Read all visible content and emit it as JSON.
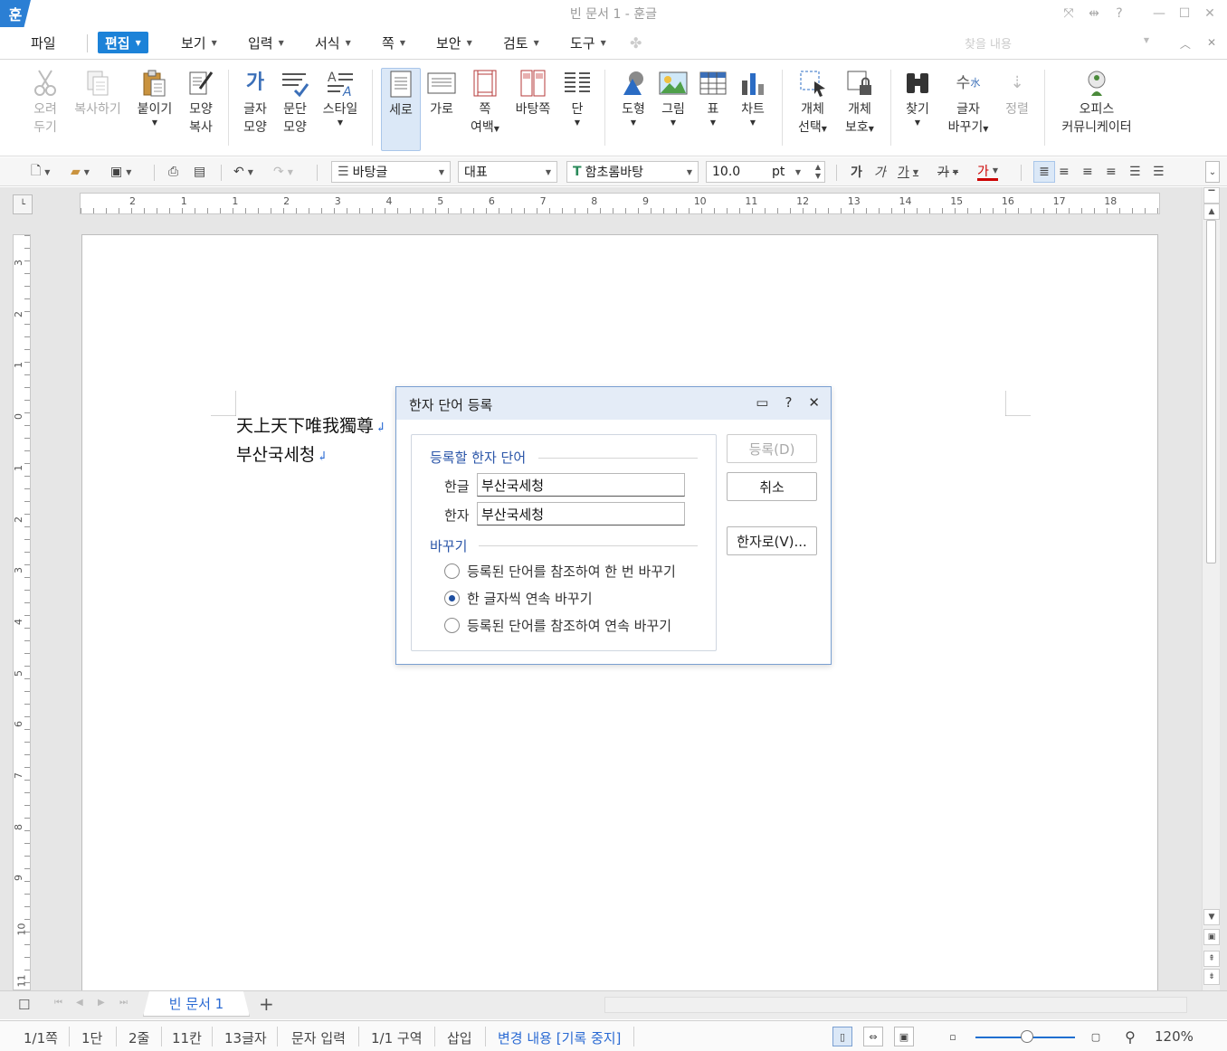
{
  "app": {
    "title": "빈 문서 1 - 훈글",
    "icon_letter": "훈"
  },
  "window_controls": [
    "full-screen-icon",
    "split-icon",
    "help-icon",
    "minimize-icon",
    "maximize-icon",
    "close-icon"
  ],
  "menubar": {
    "file": "파일",
    "items": [
      {
        "label": "편집",
        "active": true
      },
      {
        "label": "보기"
      },
      {
        "label": "입력"
      },
      {
        "label": "서식"
      },
      {
        "label": "쪽"
      },
      {
        "label": "보안"
      },
      {
        "label": "검토"
      },
      {
        "label": "도구"
      }
    ],
    "search_placeholder": "찾을 내용"
  },
  "ribbon": {
    "cut": [
      "오려",
      "두기"
    ],
    "copy": "복사하기",
    "paste": "붙이기",
    "format_copy": [
      "모양",
      "복사"
    ],
    "char_shape": [
      "글자",
      "모양"
    ],
    "para_shape": [
      "문단",
      "모양"
    ],
    "style": "스타일",
    "vertical": "세로",
    "horizontal": "가로",
    "page_margin": [
      "쪽",
      "여백"
    ],
    "base_page": "바탕쪽",
    "column": "단",
    "shape": "도형",
    "picture": "그림",
    "table": "표",
    "chart": "차트",
    "obj_select": [
      "개체",
      "선택"
    ],
    "obj_protect": [
      "개체",
      "보호"
    ],
    "find": "찾기",
    "char_replace": [
      "글자",
      "바꾸기"
    ],
    "sort": "정렬",
    "office": [
      "오피스",
      "커뮤니케이터"
    ]
  },
  "format_toolbar": {
    "style_combo": "바탕글",
    "lang_combo": "대표",
    "font_combo": "함초롬바탕",
    "size_value": "10.0",
    "size_unit": "pt",
    "bold": "가",
    "italic": "가",
    "underline": "가",
    "strike": "가",
    "color": "가"
  },
  "ruler": {
    "h_ticks": [
      "2",
      "1",
      "1",
      "2",
      "3",
      "4",
      "5",
      "6",
      "7",
      "8",
      "9",
      "10",
      "11",
      "12",
      "13",
      "14",
      "15",
      "16",
      "17",
      "18"
    ],
    "v_ticks": [
      "3",
      "2",
      "1",
      "0",
      "1",
      "2",
      "3",
      "4",
      "5",
      "6",
      "7",
      "8",
      "9",
      "10",
      "11"
    ]
  },
  "document": {
    "lines": [
      "天上天下唯我獨尊",
      "부산국세청"
    ],
    "return_mark": "↲"
  },
  "dialog": {
    "title": "한자 단어 등록",
    "group_title": "등록할 한자 단어",
    "hangul_label": "한글",
    "hangul_value": "부산국세청",
    "hanja_label": "한자",
    "hanja_value": "부산국세청",
    "replace_title": "바꾸기",
    "options": [
      {
        "label": "등록된 단어를 참조하여 한 번 바꾸기",
        "selected": false
      },
      {
        "label": "한 글자씩 연속 바꾸기",
        "selected": true
      },
      {
        "label": "등록된 단어를 참조하여 연속 바꾸기",
        "selected": false
      }
    ],
    "register_btn": "등록(D)",
    "cancel_btn": "취소",
    "hanja_btn": "한자로(V)..."
  },
  "tabs": {
    "doc_tab": "빈 문서 1",
    "add": "+"
  },
  "status": {
    "page": "1/1쪽",
    "column": "1단",
    "line": "2줄",
    "col": "11칸",
    "chars": "13글자",
    "mode": "문자 입력",
    "section": "1/1 구역",
    "insert": "삽입",
    "track": "변경 내용 [기록 중지]",
    "zoom": "120%"
  },
  "colors": {
    "accent": "#1c82d8",
    "dialog_header": "#e4ecf7",
    "group_title": "#2a55a8"
  }
}
